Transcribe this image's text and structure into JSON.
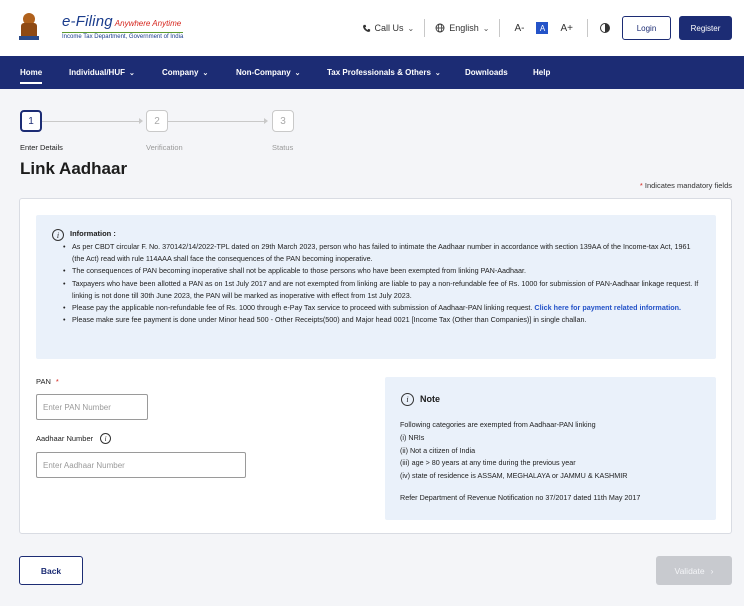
{
  "header": {
    "logo_title": "e-Filing",
    "logo_tagline": "Anywhere Anytime",
    "logo_subtitle": "Income Tax Department, Government of India",
    "call_us": "Call Us",
    "language": "English",
    "font_decrease": "A-",
    "font_default": "A",
    "font_increase": "A+",
    "login": "Login",
    "register": "Register"
  },
  "nav": {
    "items": [
      {
        "label": "Home"
      },
      {
        "label": "Individual/HUF"
      },
      {
        "label": "Company"
      },
      {
        "label": "Non-Company"
      },
      {
        "label": "Tax Professionals & Others"
      },
      {
        "label": "Downloads"
      },
      {
        "label": "Help"
      }
    ]
  },
  "stepper": {
    "steps": [
      {
        "number": "1",
        "label": "Enter Details",
        "state": "active"
      },
      {
        "number": "2",
        "label": "Verification",
        "state": "inactive"
      },
      {
        "number": "3",
        "label": "Status",
        "state": "inactive"
      }
    ]
  },
  "page": {
    "title": "Link Aadhaar",
    "mandatory_note": "Indicates mandatory fields",
    "mandatory_star": "*"
  },
  "info": {
    "title": "Information :",
    "items": [
      "As per CBDT circular F. No. 370142/14/2022-TPL dated on 29th March 2023, person who has failed to intimate the Aadhaar number in accordance with section 139AA of the Income-tax Act, 1961 (the Act) read with rule 114AAA shall face the consequences of the PAN becoming inoperative.",
      "The consequences of PAN becoming inoperative shall not be applicable to those persons who have been exempted from linking PAN-Aadhaar.",
      "Taxpayers who have been allotted a PAN as on 1st July 2017 and are not exempted from linking are liable to pay a non-refundable fee of Rs. 1000 for submission of PAN-Aadhaar linkage request. If linking is not done till 30th June 2023, the PAN will be marked as inoperative with effect from 1st July 2023.",
      "Please pay the applicable non-refundable fee of Rs. 1000 through e-Pay Tax service to proceed with submission of Aadhaar-PAN linking request.",
      "Please make sure fee payment is done under Minor head 500 - Other Receipts(500) and Major head 0021 [Income Tax (Other than Companies)] in single challan."
    ],
    "payment_link": "Click here for payment related information."
  },
  "form": {
    "pan_label": "PAN",
    "pan_placeholder": "Enter PAN Number",
    "aadhaar_label": "Aadhaar Number",
    "aadhaar_placeholder": "Enter Aadhaar Number",
    "required_star": "*"
  },
  "note": {
    "title": "Note",
    "intro": "Following categories are exempted from Aadhaar-PAN linking",
    "items": [
      "(i) NRIs",
      "(ii) Not a citizen of India",
      "(iii) age > 80 years at any time during the previous year",
      "(iv) state of residence is ASSAM, MEGHALAYA or JAMMU & KASHMIR"
    ],
    "footer": "Refer Department of Revenue Notification no 37/2017 dated 11th May 2017"
  },
  "actions": {
    "back": "Back",
    "validate": "Validate"
  },
  "colors": {
    "primary": "#1c2c74",
    "link": "#2453c8",
    "required": "#d6251d",
    "info_bg": "#eaf1fa",
    "disabled": "#c8cacf"
  }
}
